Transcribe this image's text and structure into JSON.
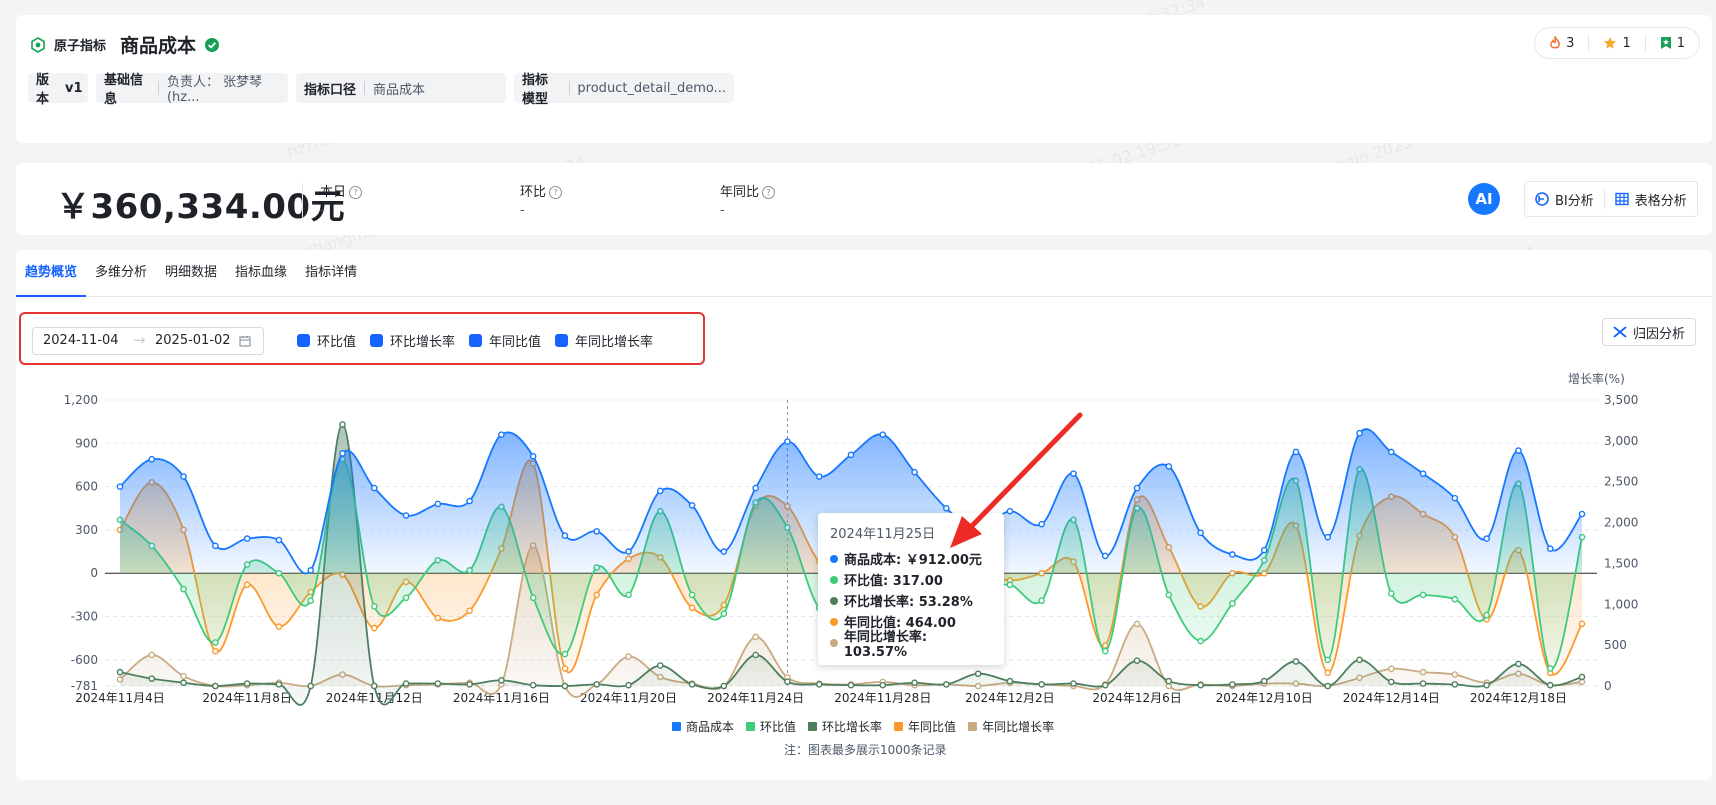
{
  "header": {
    "brand": "原子指标",
    "title": "商品成本",
    "tags": [
      {
        "label": "版本",
        "value": "v1"
      },
      {
        "label": "基础信息",
        "value": "负责人：  张梦琴(hz..."
      },
      {
        "label": "指标口径",
        "value": "商品成本"
      },
      {
        "label": "指标模型",
        "value": "product_detail_demo..."
      }
    ],
    "badges": [
      "3",
      "1",
      "1"
    ]
  },
  "kpi": {
    "value": "￥360,334.00元",
    "metrics": [
      {
        "label": "本日",
        "value": "-"
      },
      {
        "label": "环比",
        "value": "-"
      },
      {
        "label": "年同比",
        "value": "-"
      }
    ],
    "ai": "AI",
    "bi_label": "BI分析",
    "table_label": "表格分析"
  },
  "tabs": [
    "趋势概览",
    "多维分析",
    "明细数据",
    "指标血缘",
    "指标详情"
  ],
  "filters": {
    "start": "2024-11-04",
    "end": "2025-01-02",
    "checks": [
      "环比值",
      "环比增长率",
      "年同比值",
      "年同比增长率"
    ],
    "attrib_label": "归因分析"
  },
  "tooltip": {
    "date": "2024年11月25日",
    "rows": [
      {
        "label": "商品成本: ￥912.00元",
        "color": "#1677ff"
      },
      {
        "label": "环比值: 317.00",
        "color": "#3fcb7a"
      },
      {
        "label": "环比增长率: 53.28%",
        "color": "#4d7f5e"
      },
      {
        "label": "年同比值: 464.00",
        "color": "#fb9a2b"
      },
      {
        "label": "年同比增长率: 103.57%",
        "color": "#c9aa82"
      }
    ]
  },
  "note": "注：图表最多展示1000条记录",
  "watermark": "hzzhangmengqin 2025-01-02 19:32:34",
  "chart_data": {
    "type": "area",
    "x_ticks": [
      "2024年11月4日",
      "2024年11月8日",
      "2024年11月12日",
      "2024年11月16日",
      "2024年11月20日",
      "2024年11月24日",
      "2024年11月28日",
      "2024年12月2日",
      "2024年12月6日",
      "2024年12月10日",
      "2024年12月14日",
      "2024年12月18日"
    ],
    "y_left_ticks": [
      "1,200",
      "900",
      "600",
      "300",
      "0",
      "-300",
      "-600",
      "-781"
    ],
    "y_right_ticks": [
      "3,500",
      "3,000",
      "2,500",
      "2,000",
      "1,500",
      "1,000",
      "500",
      "0"
    ],
    "y_right_label": "增长率(%)",
    "ylim_left": [
      -781,
      1200
    ],
    "ylim_right": [
      0,
      3500
    ],
    "series": [
      {
        "name": "商品成本",
        "axis": "left",
        "color": "#1677ff",
        "values": [
          600,
          790,
          670,
          190,
          240,
          230,
          20,
          830,
          590,
          400,
          480,
          500,
          960,
          810,
          260,
          290,
          150,
          570,
          470,
          150,
          590,
          912,
          670,
          820,
          960,
          700,
          450,
          300,
          430,
          340,
          690,
          120,
          590,
          740,
          280,
          130,
          160,
          840,
          250,
          970,
          840,
          690,
          520,
          240,
          850,
          170,
          410
        ]
      },
      {
        "name": "环比值",
        "axis": "left",
        "color": "#3fcb7a",
        "values": [
          370,
          190,
          -110,
          -480,
          60,
          0,
          -190,
          790,
          -230,
          -170,
          90,
          20,
          460,
          -170,
          -560,
          40,
          -150,
          430,
          -150,
          -280,
          490,
          317,
          -240,
          -200,
          -90,
          -100,
          -180,
          -120,
          -80,
          -190,
          370,
          -540,
          450,
          -150,
          -470,
          -210,
          90,
          640,
          -600,
          720,
          -140,
          -150,
          -180,
          -290,
          620,
          -660,
          250
        ]
      },
      {
        "name": "环比增长率",
        "axis": "right",
        "color": "#4d7f5e",
        "values": [
          170,
          90,
          40,
          0,
          30,
          20,
          0,
          3200,
          0,
          30,
          30,
          20,
          70,
          10,
          0,
          20,
          10,
          250,
          20,
          0,
          380,
          53,
          20,
          10,
          10,
          40,
          20,
          150,
          60,
          20,
          30,
          10,
          310,
          60,
          10,
          20,
          60,
          300,
          0,
          320,
          50,
          30,
          20,
          10,
          270,
          10,
          110
        ]
      },
      {
        "name": "年同比值",
        "axis": "left",
        "color": "#fb9a2b",
        "values": [
          300,
          630,
          300,
          -540,
          -80,
          -370,
          -130,
          -10,
          -380,
          -60,
          -310,
          -260,
          170,
          760,
          -660,
          -150,
          100,
          110,
          -240,
          -220,
          470,
          464,
          80,
          -30,
          -60,
          -90,
          -30,
          10,
          -50,
          0,
          80,
          -500,
          510,
          180,
          -230,
          0,
          0,
          330,
          -690,
          260,
          530,
          410,
          250,
          -320,
          160,
          -690,
          -350
        ]
      },
      {
        "name": "年同比增长率",
        "axis": "right",
        "color": "#c9aa82",
        "values": [
          80,
          380,
          120,
          0,
          10,
          40,
          0,
          140,
          0,
          10,
          20,
          40,
          20,
          1720,
          0,
          20,
          360,
          110,
          30,
          0,
          600,
          104,
          30,
          20,
          50,
          10,
          20,
          0,
          40,
          20,
          0,
          20,
          760,
          0,
          20,
          0,
          30,
          30,
          0,
          100,
          210,
          170,
          140,
          40,
          150,
          10,
          50
        ]
      }
    ]
  }
}
